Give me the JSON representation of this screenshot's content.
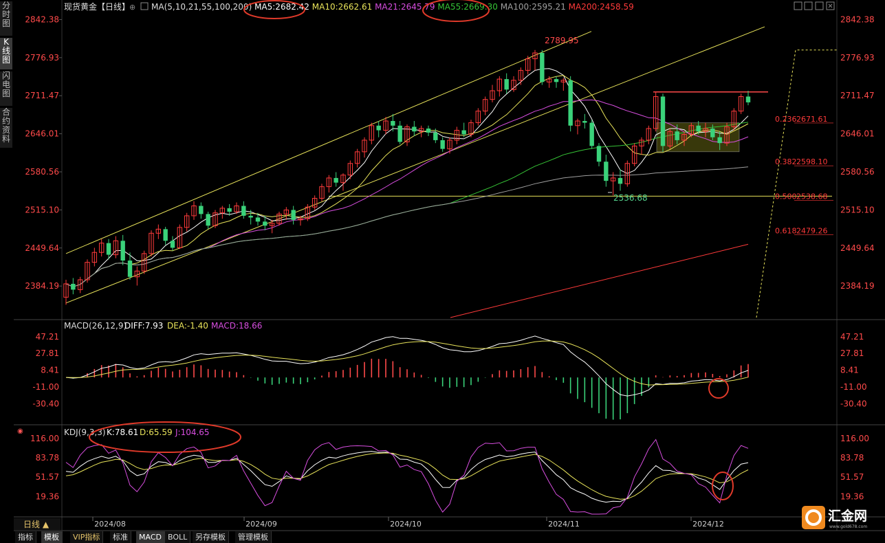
{
  "sidebar": {
    "tabs": [
      {
        "label": "分时图"
      },
      {
        "label": "K线图"
      },
      {
        "label": "闪电图"
      },
      {
        "label": "合约资料"
      }
    ]
  },
  "toolbar": {
    "tabs": [
      {
        "label": "指标"
      },
      {
        "label": "模板"
      },
      {
        "label": "VIP指标"
      },
      {
        "label": "标准"
      },
      {
        "label": "MACD"
      },
      {
        "label": "BOLL"
      },
      {
        "label": "另存模板"
      },
      {
        "label": "管理模板"
      }
    ],
    "period": "日线 ▲"
  },
  "header": {
    "title": "现货黄金【日线】",
    "ma_items": [
      {
        "text": "MA(5,10,21,55,100,200)",
        "color": "#dddddd"
      },
      {
        "text": "MA5:2682.42",
        "color": "#ffffff"
      },
      {
        "text": "MA10:2662.61",
        "color": "#e8e35a"
      },
      {
        "text": "MA21:2645.79",
        "color": "#d84ee0"
      },
      {
        "text": "MA55:2669.30",
        "color": "#36c436"
      },
      {
        "text": "MA100:2595.21",
        "color": "#a0a0a0"
      },
      {
        "text": "MA200:2458.59",
        "color": "#ff3a3a"
      }
    ]
  },
  "logo": {
    "name": "汇金网",
    "url": "www.gold678.com"
  },
  "chart_data": [
    {
      "type": "candlestick",
      "name": "main",
      "ylim": [
        2330,
        2850
      ],
      "y_ticks": [
        "2842.38",
        "2776.93",
        "2711.47",
        "2646.01",
        "2580.56",
        "2515.10",
        "2449.64",
        "2384.19"
      ],
      "x_ticks": [
        "2024/08",
        "2024/09",
        "2024/10",
        "2024/11",
        "2024/12"
      ],
      "annotations": [
        {
          "text": "2789.95",
          "color": "#ff4a4a"
        },
        {
          "text": "2536.68",
          "color": "#55d48e"
        }
      ],
      "fib_levels": [
        {
          "text": "0.236",
          "value": "2671.61"
        },
        {
          "text": "0.382",
          "value": "2598.10"
        },
        {
          "text": "0.500",
          "value": "2538.68"
        },
        {
          "text": "0.618",
          "value": "2479.26"
        }
      ],
      "ohlc": [
        [
          2365,
          2395,
          2352,
          2388
        ],
        [
          2388,
          2398,
          2370,
          2378
        ],
        [
          2378,
          2400,
          2372,
          2395
        ],
        [
          2395,
          2430,
          2390,
          2425
        ],
        [
          2425,
          2450,
          2418,
          2442
        ],
        [
          2442,
          2465,
          2435,
          2458
        ],
        [
          2458,
          2465,
          2430,
          2438
        ],
        [
          2438,
          2470,
          2432,
          2462
        ],
        [
          2462,
          2472,
          2420,
          2428
        ],
        [
          2428,
          2442,
          2395,
          2400
        ],
        [
          2400,
          2418,
          2385,
          2410
        ],
        [
          2410,
          2445,
          2405,
          2440
        ],
        [
          2440,
          2480,
          2435,
          2475
        ],
        [
          2475,
          2490,
          2465,
          2482
        ],
        [
          2482,
          2486,
          2455,
          2462
        ],
        [
          2462,
          2470,
          2445,
          2450
        ],
        [
          2450,
          2490,
          2448,
          2485
        ],
        [
          2485,
          2510,
          2478,
          2505
        ],
        [
          2505,
          2530,
          2498,
          2522
        ],
        [
          2522,
          2528,
          2500,
          2508
        ],
        [
          2508,
          2512,
          2482,
          2488
        ],
        [
          2488,
          2515,
          2484,
          2510
        ],
        [
          2510,
          2522,
          2500,
          2518
        ],
        [
          2518,
          2525,
          2505,
          2512
        ],
        [
          2512,
          2528,
          2508,
          2522
        ],
        [
          2522,
          2530,
          2500,
          2505
        ],
        [
          2505,
          2515,
          2490,
          2502
        ],
        [
          2502,
          2510,
          2488,
          2495
        ],
        [
          2495,
          2505,
          2480,
          2488
        ],
        [
          2488,
          2498,
          2475,
          2492
        ],
        [
          2492,
          2512,
          2488,
          2508
        ],
        [
          2508,
          2520,
          2498,
          2515
        ],
        [
          2515,
          2522,
          2490,
          2498
        ],
        [
          2498,
          2505,
          2488,
          2500
        ],
        [
          2500,
          2525,
          2496,
          2520
        ],
        [
          2520,
          2540,
          2515,
          2535
        ],
        [
          2535,
          2560,
          2530,
          2555
        ],
        [
          2555,
          2575,
          2545,
          2570
        ],
        [
          2570,
          2580,
          2555,
          2562
        ],
        [
          2562,
          2578,
          2548,
          2575
        ],
        [
          2575,
          2600,
          2568,
          2595
        ],
        [
          2595,
          2620,
          2588,
          2615
        ],
        [
          2615,
          2640,
          2605,
          2635
        ],
        [
          2635,
          2665,
          2628,
          2660
        ],
        [
          2660,
          2668,
          2640,
          2652
        ],
        [
          2652,
          2675,
          2645,
          2668
        ],
        [
          2668,
          2680,
          2650,
          2660
        ],
        [
          2660,
          2668,
          2628,
          2632
        ],
        [
          2632,
          2662,
          2625,
          2658
        ],
        [
          2658,
          2668,
          2642,
          2650
        ],
        [
          2650,
          2660,
          2640,
          2655
        ],
        [
          2655,
          2660,
          2642,
          2648
        ],
        [
          2648,
          2655,
          2630,
          2635
        ],
        [
          2635,
          2640,
          2615,
          2620
        ],
        [
          2620,
          2640,
          2612,
          2635
        ],
        [
          2635,
          2658,
          2628,
          2652
        ],
        [
          2652,
          2665,
          2640,
          2645
        ],
        [
          2645,
          2670,
          2640,
          2665
        ],
        [
          2665,
          2690,
          2660,
          2685
        ],
        [
          2685,
          2710,
          2678,
          2705
        ],
        [
          2705,
          2730,
          2700,
          2720
        ],
        [
          2720,
          2745,
          2710,
          2740
        ],
        [
          2740,
          2750,
          2715,
          2722
        ],
        [
          2722,
          2745,
          2718,
          2738
        ],
        [
          2738,
          2760,
          2730,
          2755
        ],
        [
          2755,
          2780,
          2748,
          2775
        ],
        [
          2775,
          2790,
          2755,
          2785
        ],
        [
          2785,
          2790,
          2730,
          2735
        ],
        [
          2735,
          2745,
          2725,
          2740
        ],
        [
          2740,
          2745,
          2725,
          2735
        ],
        [
          2735,
          2742,
          2720,
          2738
        ],
        [
          2738,
          2745,
          2650,
          2660
        ],
        [
          2660,
          2672,
          2645,
          2668
        ],
        [
          2668,
          2680,
          2655,
          2665
        ],
        [
          2665,
          2670,
          2620,
          2625
        ],
        [
          2625,
          2630,
          2590,
          2598
        ],
        [
          2598,
          2610,
          2555,
          2565
        ],
        [
          2565,
          2580,
          2540,
          2570
        ],
        [
          2570,
          2585,
          2548,
          2560
        ],
        [
          2560,
          2600,
          2555,
          2595
        ],
        [
          2595,
          2630,
          2590,
          2625
        ],
        [
          2625,
          2640,
          2610,
          2635
        ],
        [
          2635,
          2660,
          2628,
          2655
        ],
        [
          2655,
          2718,
          2650,
          2710
        ],
        [
          2710,
          2715,
          2615,
          2625
        ],
        [
          2625,
          2655,
          2620,
          2650
        ],
        [
          2650,
          2662,
          2628,
          2635
        ],
        [
          2635,
          2650,
          2625,
          2645
        ],
        [
          2645,
          2665,
          2640,
          2660
        ],
        [
          2660,
          2668,
          2645,
          2650
        ],
        [
          2650,
          2665,
          2640,
          2655
        ],
        [
          2655,
          2662,
          2635,
          2640
        ],
        [
          2640,
          2650,
          2618,
          2630
        ],
        [
          2630,
          2665,
          2625,
          2658
        ],
        [
          2658,
          2690,
          2652,
          2685
        ],
        [
          2685,
          2715,
          2680,
          2710
        ],
        [
          2710,
          2720,
          2695,
          2700
        ]
      ],
      "ma_periods": [
        5,
        10,
        21,
        55,
        100,
        200
      ]
    },
    {
      "type": "macd",
      "title": "MACD(26,12,9)",
      "diff": "DIFF:7.93",
      "dea": "DEA:-1.40",
      "macd": "MACD:18.66",
      "ylim": [
        -50,
        55
      ],
      "y_ticks": [
        "47.21",
        "27.81",
        "8.41",
        "-11.00",
        "-30.40"
      ]
    },
    {
      "type": "kdj",
      "title": "KDJ(9,3,3)",
      "k": "K:78.61",
      "d": "D:65.59",
      "j": "J:104.65",
      "ylim": [
        -10,
        125
      ],
      "y_ticks": [
        "116.00",
        "83.78",
        "51.57",
        "19.36"
      ]
    }
  ]
}
